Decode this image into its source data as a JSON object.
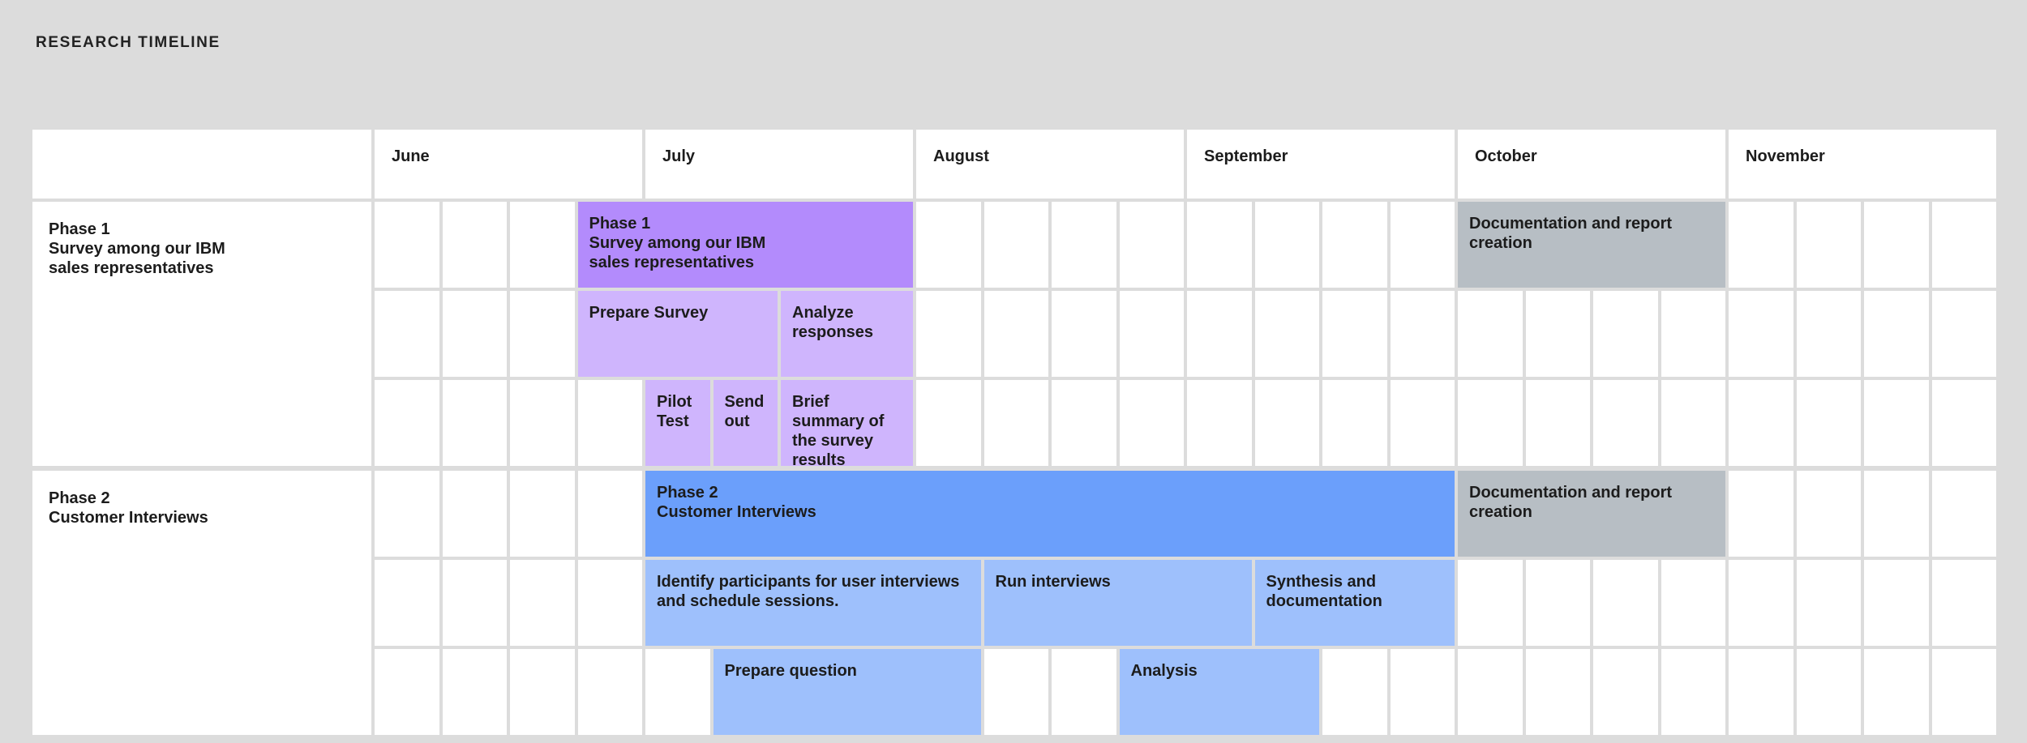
{
  "page_title": "RESEARCH TIMELINE",
  "months": [
    "June",
    "July",
    "August",
    "September",
    "October",
    "November"
  ],
  "colors": {
    "background": "#dcdcdc",
    "cell": "#ffffff",
    "phase1_header": "#b38bfc",
    "phase1_task": "#cfb5fd",
    "phase2_header": "#6b9ffb",
    "phase2_task": "#9ec0fc",
    "documentation": "#b7bec4"
  },
  "phases": [
    {
      "label_title": "Phase 1",
      "label_desc": "Survey among our IBM\nsales representatives",
      "tasks": [
        {
          "title": "Phase 1",
          "text": "Survey among our IBM\nsales representatives",
          "kind": "phase1_header",
          "row": 0,
          "start": 3,
          "span": 5
        },
        {
          "title": "",
          "text": "Documentation and report\ncreation",
          "kind": "documentation",
          "row": 0,
          "start": 16,
          "span": 4
        },
        {
          "title": "",
          "text": "Prepare Survey",
          "kind": "phase1_task",
          "row": 1,
          "start": 3,
          "span": 3
        },
        {
          "title": "",
          "text": "Analyze\nresponses",
          "kind": "phase1_task",
          "row": 1,
          "start": 6,
          "span": 2
        },
        {
          "title": "",
          "text": "Pilot\nTest",
          "kind": "phase1_task",
          "row": 2,
          "start": 4,
          "span": 1
        },
        {
          "title": "",
          "text": "Send\nout",
          "kind": "phase1_task",
          "row": 2,
          "start": 5,
          "span": 1
        },
        {
          "title": "",
          "text": "Brief\nsummary of\nthe survey\nresults",
          "kind": "phase1_task",
          "row": 2,
          "start": 6,
          "span": 2
        }
      ]
    },
    {
      "label_title": "Phase 2",
      "label_desc": "Customer Interviews",
      "tasks": [
        {
          "title": "Phase 2",
          "text": "Customer Interviews",
          "kind": "phase2_header",
          "row": 0,
          "start": 4,
          "span": 12
        },
        {
          "title": "",
          "text": "Documentation and report\ncreation",
          "kind": "documentation",
          "row": 0,
          "start": 16,
          "span": 4
        },
        {
          "title": "",
          "text": "Identify participants for user interviews\nand schedule sessions.",
          "kind": "phase2_task",
          "row": 1,
          "start": 4,
          "span": 5
        },
        {
          "title": "",
          "text": "Run interviews",
          "kind": "phase2_task",
          "row": 1,
          "start": 9,
          "span": 4
        },
        {
          "title": "",
          "text": "Synthesis and\ndocumentation",
          "kind": "phase2_task",
          "row": 1,
          "start": 13,
          "span": 3
        },
        {
          "title": "",
          "text": "Prepare question",
          "kind": "phase2_task",
          "row": 2,
          "start": 5,
          "span": 4
        },
        {
          "title": "",
          "text": "Analysis",
          "kind": "phase2_task",
          "row": 2,
          "start": 11,
          "span": 3
        }
      ]
    }
  ]
}
